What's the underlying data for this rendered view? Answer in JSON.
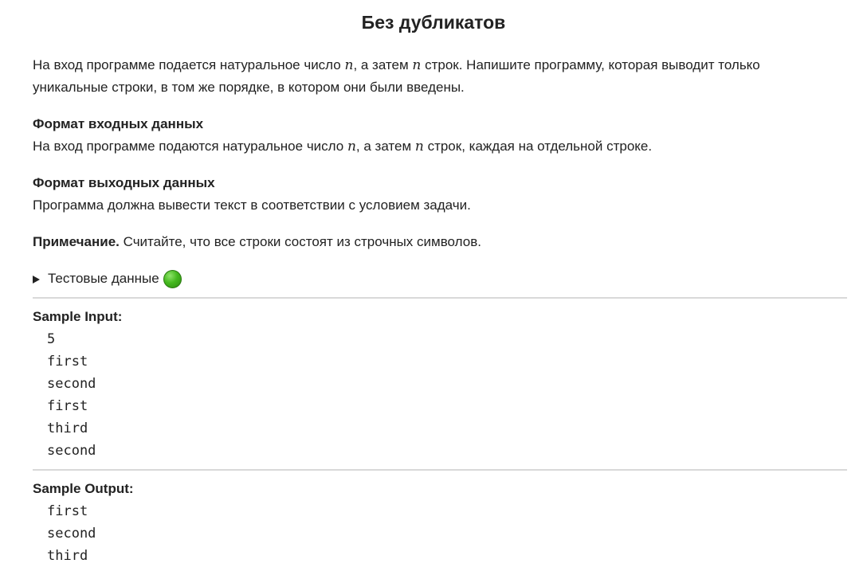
{
  "title": "Без дубликатов",
  "statement": {
    "line1_a": "На вход программе подается натуральное число ",
    "var_n": "n",
    "line1_b": ", а затем ",
    "line1_c": " строк. Напишите программу, которая выводит только",
    "line2": "уникальные строки, в том же порядке, в котором они были введены."
  },
  "input_format": {
    "heading": "Формат входных данных",
    "text_a": "На вход программе подаются натуральное число ",
    "text_b": ", а затем ",
    "text_c": " строк, каждая на отдельной строке."
  },
  "output_format": {
    "heading": "Формат выходных данных",
    "text": "Программа должна вывести текст в соответствии с условием задачи."
  },
  "note": {
    "label": "Примечание.",
    "text": " Считайте, что все строки состоят из строчных символов."
  },
  "test_data": {
    "label": "Тестовые данные",
    "status_icon": "green-circle-icon",
    "status_color": "#45b91f"
  },
  "sample_input": {
    "label": "Sample Input:",
    "lines": [
      "5",
      "first",
      "second",
      "first",
      "third",
      "second"
    ]
  },
  "sample_output": {
    "label": "Sample Output:",
    "lines": [
      "first",
      "second",
      "third"
    ]
  }
}
